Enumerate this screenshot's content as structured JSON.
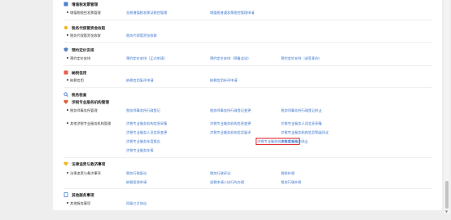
{
  "sections": {
    "s0": {
      "title": "增值税发票管理",
      "sub": "增值税税控发票管理",
      "links": [
        "金税增值税发票证税控管理",
        "增值税普通发票税控管理申请"
      ]
    },
    "s1": {
      "title": "税务代保管资金收取",
      "sub": "税务代保管资金收取",
      "links": [
        "税务代保管资金收取"
      ]
    },
    "s2": {
      "title": "预约定价安排",
      "sub": "预约定价安排",
      "links": [
        "预约定价安排（正式申请）",
        "预约定价安排（预备会谈）",
        "预约定价安排（谈签意向）"
      ]
    },
    "s3": {
      "title": "納税信用",
      "sub": "纳税信用",
      "links": [
        "纳税信用复评申请",
        "纳税信用补评申请"
      ]
    },
    "s4": {
      "title": "税务检查"
    },
    "s5": {
      "title": "涉税专业服务机构管理",
      "sub1": "税务师事务所管理",
      "sub2": "其他涉税专业服务机构管理",
      "row1": [
        "税务师事务所行政登记",
        "税务师事务所行政登记变更",
        "税务师事务所行政登记终止"
      ],
      "grid": [
        [
          "涉税专业服务机构信息采集",
          "涉税专业服务机构信息变更",
          "涉税专业服务人员信息采集"
        ],
        [
          "涉税专业服务人员信息变更",
          "涉税专业服务机构信用复评",
          "涉税专业服务机构信用等级异议"
        ],
        [
          "涉税专业服务年度报告",
          "涉税专业服务机构年度报告",
          "涉税专业服务终止"
        ],
        [
          "涉税专业服务年报"
        ]
      ]
    },
    "s6": {
      "title": "法律追责与救济事项",
      "sub": "法律追责与救济事项",
      "row1": [
        "税务行政复议",
        "税务行政诉讼",
        "税收补偿"
      ],
      "row2": [
        "纳税担保申请",
        "退税申请人执行的办理",
        "税务行政补偿"
      ]
    },
    "s7": {
      "title": "其他服务事项",
      "sub": "其他服务事项",
      "links": [
        "同级三方协议"
      ]
    }
  },
  "colors": {
    "link": "#3a73c9",
    "highlight_border": "#e0252a",
    "panel": "#ffffff",
    "background": "#eeeeee"
  }
}
